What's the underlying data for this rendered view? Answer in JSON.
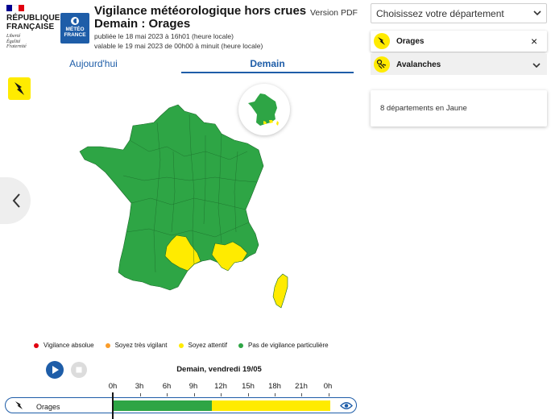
{
  "header": {
    "rf_name": [
      "RÉPUBLIQUE",
      "FRANÇAISE"
    ],
    "rf_motto": [
      "Liberté",
      "Égalité",
      "Fraternité"
    ],
    "mf_logo": [
      "MÉTÉO",
      "FRANCE"
    ],
    "title": "Vigilance météorologique hors crues",
    "subtitle": "Demain : Orages",
    "published": "publiée le 18 mai 2023 à 16h01 (heure locale)",
    "valid": "valable le 19 mai 2023 de 00h00 à minuit (heure locale)",
    "pdf_link": "Version PDF"
  },
  "tabs": [
    {
      "label": "Aujourd'hui",
      "active": false
    },
    {
      "label": "Demain",
      "active": true
    }
  ],
  "legend": [
    {
      "label": "Vigilance absolue",
      "color": "#e1000f"
    },
    {
      "label": "Soyez très vigilant",
      "color": "#fa9c2a"
    },
    {
      "label": "Soyez attentif",
      "color": "#ffeb00"
    },
    {
      "label": "Pas de vigilance particulière",
      "color": "#2ea545"
    }
  ],
  "timeline": {
    "day_label": "Demain, vendredi 19/05",
    "hours": [
      "0h",
      "3h",
      "6h",
      "9h",
      "12h",
      "15h",
      "18h",
      "21h",
      "0h"
    ],
    "row_label": "Orages",
    "segments": [
      {
        "from_hour": 0,
        "to_hour": 11,
        "color": "#2ea545"
      },
      {
        "from_hour": 11,
        "to_hour": 24,
        "color": "#ffeb00"
      }
    ]
  },
  "sidebar": {
    "select_placeholder": "Choisissez votre département",
    "phenomena": [
      {
        "label": "Orages",
        "icon": "lightning-icon",
        "action": "×"
      },
      {
        "label": "Avalanches",
        "icon": "avalanche-icon",
        "action": "chevron-down"
      }
    ],
    "count_text": "8 départements en Jaune"
  },
  "colors": {
    "accent": "#1e5da8",
    "green": "#2ea545",
    "yellow": "#ffeb00"
  }
}
